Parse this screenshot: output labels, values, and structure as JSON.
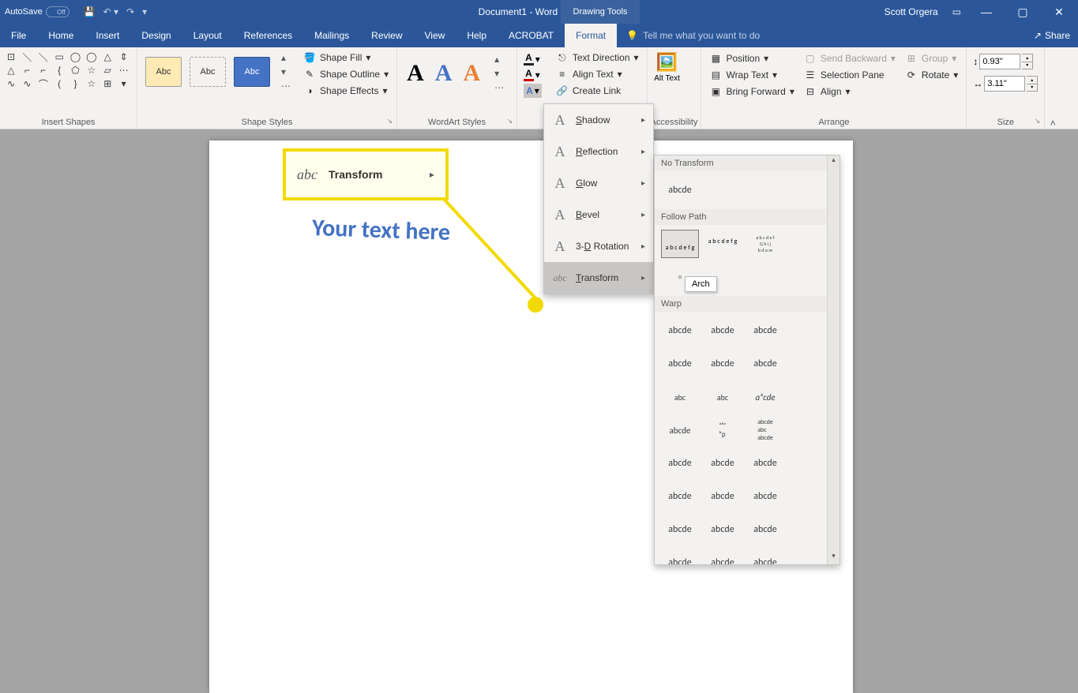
{
  "title_bar": {
    "autosave_label": "AutoSave",
    "autosave_state": "Off",
    "doc_title": "Document1  -  Word",
    "context_tab": "Drawing Tools",
    "user_name": "Scott Orgera"
  },
  "menu": {
    "file": "File",
    "home": "Home",
    "insert": "Insert",
    "design": "Design",
    "layout": "Layout",
    "references": "References",
    "mailings": "Mailings",
    "review": "Review",
    "view": "View",
    "help": "Help",
    "acrobat": "ACROBAT",
    "format": "Format",
    "tell_me": "Tell me what you want to do",
    "share": "Share"
  },
  "ribbon": {
    "groups": {
      "insert_shapes": "Insert Shapes",
      "shape_styles": "Shape Styles",
      "wordart_styles": "WordArt Styles",
      "accessibility": "Accessibility",
      "arrange": "Arrange",
      "size": "Size"
    },
    "shape_styles": {
      "sample": "Abc",
      "fill": "Shape Fill",
      "outline": "Shape Outline",
      "effects": "Shape Effects"
    },
    "wordart": {
      "letter": "A"
    },
    "text": {
      "direction": "Text Direction",
      "align": "Align Text",
      "link": "Create Link"
    },
    "alt_text": "Alt Text",
    "arrange": {
      "position": "Position",
      "wrap": "Wrap Text",
      "forward": "Bring Forward",
      "backward": "Send Backward",
      "selection": "Selection Pane",
      "align": "Align",
      "group": "Group",
      "rotate": "Rotate"
    },
    "size": {
      "height": "0.93\"",
      "width": "3.11\""
    }
  },
  "effects_menu": {
    "shadow": "Shadow",
    "reflection": "Reflection",
    "glow": "Glow",
    "bevel": "Bevel",
    "rot3d": "3-D Rotation",
    "transform": "Transform"
  },
  "transform_panel": {
    "no_transform": "No Transform",
    "follow_path": "Follow Path",
    "warp": "Warp",
    "sample_none": "abcde",
    "path_1": "a b c d e f g",
    "path_2": "a b c d e f g",
    "path_3": "a b c d e f   G h i j   b d o m u w",
    "warp_sample": "abcde",
    "tooltip": "Arch"
  },
  "callout": {
    "icon": "abc",
    "label": "Transform"
  },
  "canvas": {
    "wordart_text": "Your text here"
  }
}
